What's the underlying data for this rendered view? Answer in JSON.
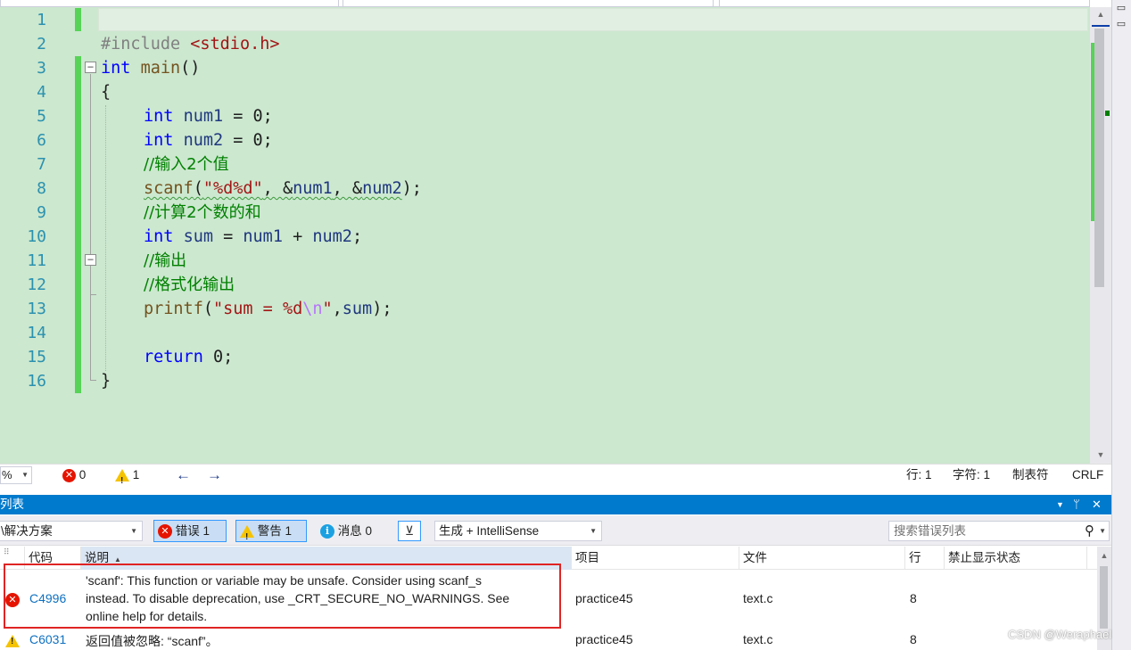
{
  "editor": {
    "line_numbers": [
      "1",
      "2",
      "3",
      "4",
      "5",
      "6",
      "7",
      "8",
      "9",
      "10",
      "11",
      "12",
      "13",
      "14",
      "15",
      "16"
    ],
    "lines": {
      "l2": {
        "pp": "#include",
        "inc": "<stdio.h>"
      },
      "l3": {
        "kw": "int",
        "fn": "main",
        "rest": "()"
      },
      "l4": "{",
      "l5": {
        "kw": "int",
        "var": "num1",
        "rest": " = 0;"
      },
      "l6": {
        "kw": "int",
        "var": "num2",
        "rest": " = 0;"
      },
      "l7": "//输入2个值",
      "l8": {
        "fn": "scanf",
        "p1": "(",
        "str": "\"%d%d\"",
        "p2": ", &",
        "v1": "num1",
        "p3": ", &",
        "v2": "num2",
        "p4": ");"
      },
      "l9": "//计算2个数的和",
      "l10": {
        "kw": "int",
        "v1": "sum",
        "p1": " = ",
        "v2": "num1",
        "p2": " + ",
        "v3": "num2",
        "p3": ";"
      },
      "l11": "//输出",
      "l12": "//格式化输出",
      "l13": {
        "fn": "printf",
        "p1": "(",
        "s1": "\"sum = ",
        "fmt": "%d",
        "esc": "\\n",
        "s2": "\"",
        "p2": ",",
        "var": "sum",
        "p3": ");"
      },
      "l15": {
        "kw": "return",
        "rest": " 0;"
      },
      "l16": "}"
    }
  },
  "editor_status": {
    "zoom": "%",
    "errors": "0",
    "warnings": "1",
    "line": "行: 1",
    "char": "字符: 1",
    "tabs": "制表符",
    "eol": "CRLF"
  },
  "error_list": {
    "title": "列表",
    "scope_combo": "\\解决方案",
    "errors_toggle": "错误 1",
    "warnings_toggle": "警告 1",
    "messages_toggle": "消息 0",
    "build_combo": "生成 + IntelliSense",
    "search_placeholder": "搜索错误列表",
    "columns": {
      "code": "代码",
      "description": "说明",
      "project": "项目",
      "file": "文件",
      "line": "行",
      "suppression": "禁止显示状态"
    },
    "rows": [
      {
        "code": "C4996",
        "desc_1": "'scanf': This function or variable may be unsafe. Consider using scanf_s",
        "desc_2": "instead. To disable deprecation, use _CRT_SECURE_NO_WARNINGS. See",
        "desc_3": "online help for details.",
        "project": "practice45",
        "file": "text.c",
        "line": "8"
      },
      {
        "code": "C6031",
        "desc_1": "返回值被忽略: “scanf”。",
        "project": "practice45",
        "file": "text.c",
        "line": "8"
      }
    ]
  },
  "watermark": "CSDN @Weraphael",
  "colors": {
    "editor_bg": "#cce8cf",
    "change_bar": "#57d357",
    "keyword": "#0000ff",
    "comment": "#008000",
    "string": "#a31515",
    "accent": "#007acc",
    "error": "#e51400",
    "highlight_box": "#e02424"
  }
}
